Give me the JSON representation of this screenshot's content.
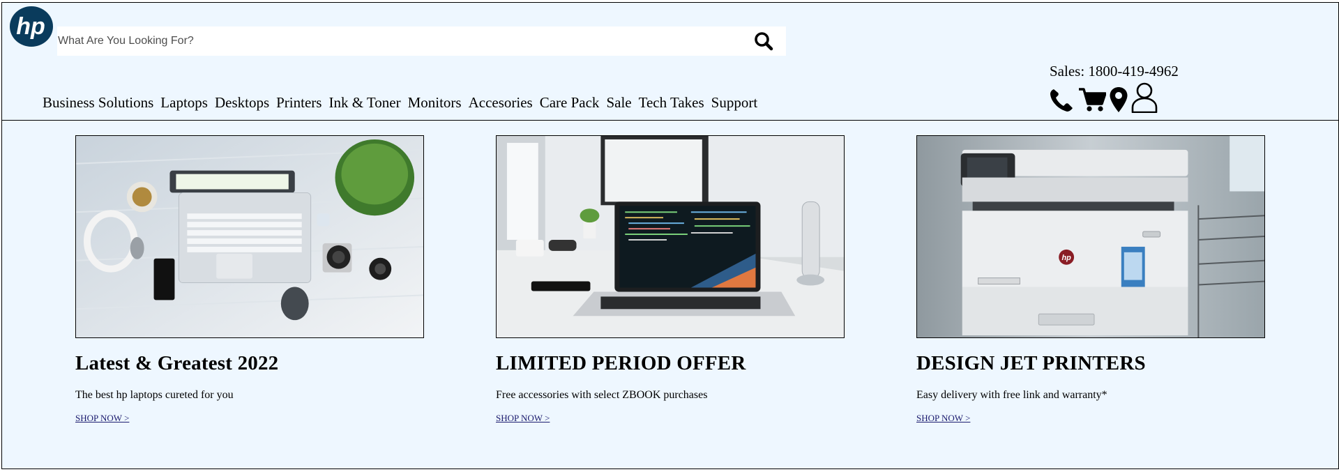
{
  "brand": {
    "logo_text": "hp",
    "logo_color": "#0a3b5c"
  },
  "search": {
    "placeholder": "What Are You Looking For?",
    "icon": "search-icon"
  },
  "contact": {
    "sales": "Sales: 1800-419-4962"
  },
  "header_icons": [
    "phone-icon",
    "cart-icon",
    "location-pin-icon",
    "user-icon"
  ],
  "nav": {
    "items": [
      "Business Solutions",
      "Laptops",
      "Desktops",
      "Printers",
      "Ink & Toner",
      "Monitors",
      "Accesories",
      "Care Pack",
      "Sale",
      "Tech Takes",
      "Support"
    ]
  },
  "cards": [
    {
      "title": "Latest & Greatest 2022",
      "description": "The best hp laptops cureted for you",
      "link": "SHOP NOW >",
      "image": "laptop-desk-flatlay"
    },
    {
      "title": "LIMITED PERIOD OFFER",
      "description": "Free accessories with select ZBOOK purchases",
      "link": "SHOP NOW >",
      "image": "laptop-code-on-desk"
    },
    {
      "title": "DESIGN JET PRINTERS",
      "description": "Easy delivery with free link and warranty*",
      "link": "SHOP NOW >",
      "image": "hp-laser-printer"
    }
  ],
  "colors": {
    "background": "#eef7ff",
    "link": "#1a1a6e"
  }
}
